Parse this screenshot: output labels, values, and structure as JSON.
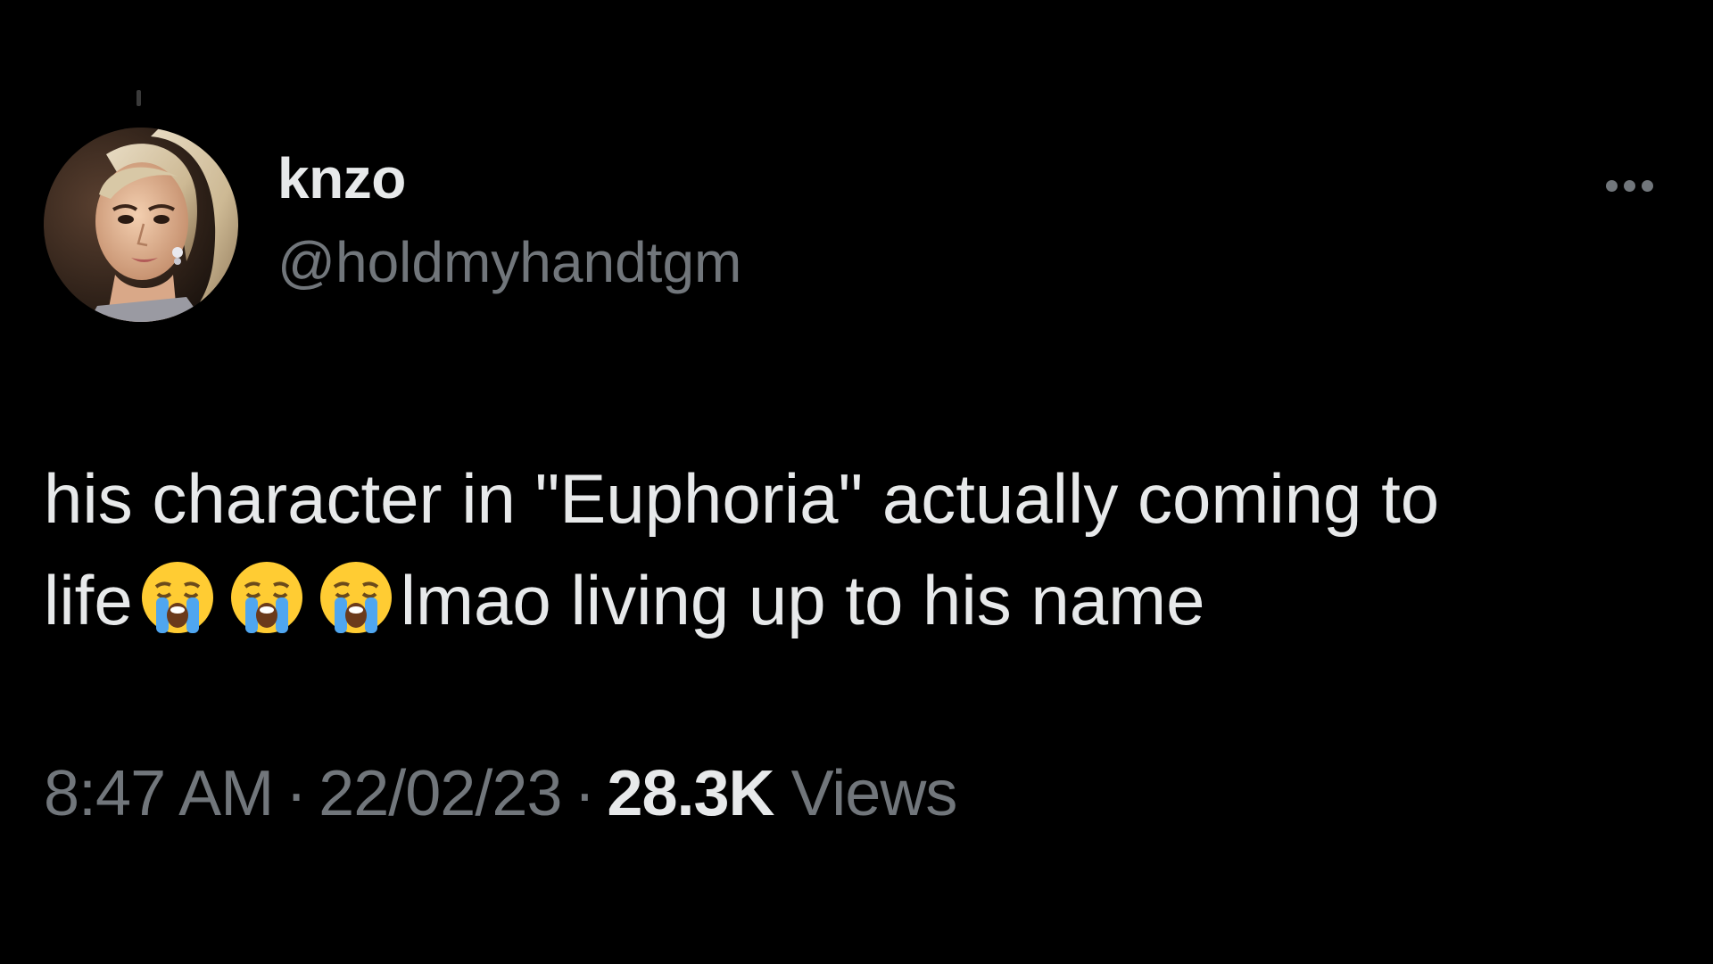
{
  "tweet": {
    "author": {
      "display_name": "knzo",
      "handle": "@holdmyhandtgm",
      "avatar_icon": "profile-photo"
    },
    "more_icon": "more-horizontal-icon",
    "text": {
      "line1": "his character in \"Euphoria\" actually coming to",
      "line2_start": "life",
      "emoji": "loudly-crying-face",
      "line2_end": "lmao living up to his name"
    },
    "meta": {
      "time": "8:47 AM",
      "separator": "·",
      "date": "22/02/23",
      "views_count": "28.3K",
      "views_label": "Views"
    }
  },
  "colors": {
    "background": "#000000",
    "primary_text": "#e7e9ea",
    "secondary_text": "#71767b"
  }
}
